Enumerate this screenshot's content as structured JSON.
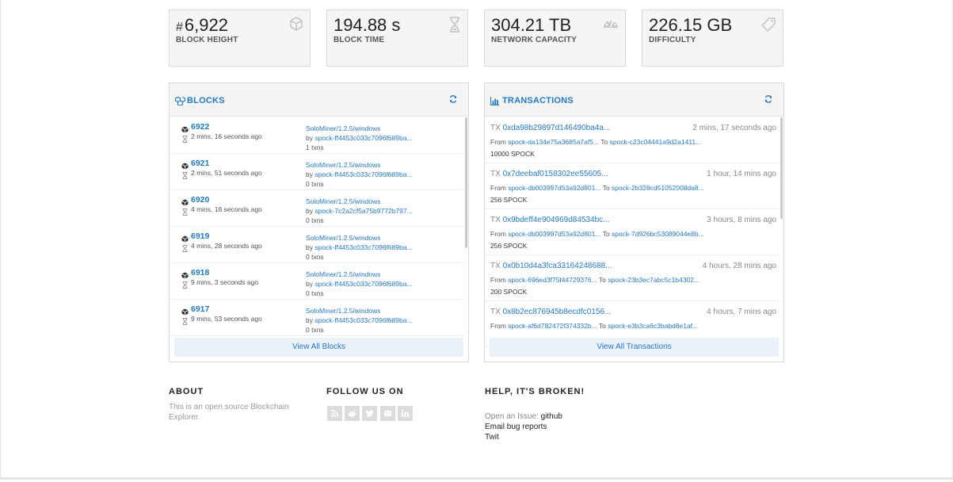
{
  "stats": [
    {
      "prefix": "#",
      "value": "6,922",
      "label": "BLOCK HEIGHT",
      "icon": "cube-icon"
    },
    {
      "prefix": "",
      "value": "194.88 s",
      "label": "BLOCK TIME",
      "icon": "hourglass-icon"
    },
    {
      "prefix": "",
      "value": "304.21 TB",
      "label": "NETWORK CAPACITY",
      "icon": "dashboard-icon"
    },
    {
      "prefix": "",
      "value": "226.15 GB",
      "label": "DIFFICULTY",
      "icon": "tag-icon"
    }
  ],
  "blocks_panel": {
    "title": "BLOCKS",
    "view_all": "View All Blocks",
    "items": [
      {
        "number": "6922",
        "time": "2 mins, 16 seconds ago",
        "miner": "SoloMiner/1.2.5/windows",
        "by_prefix": "by ",
        "by": "spock-ff4453c033c7096f689ba...",
        "txns": "1 txns"
      },
      {
        "number": "6921",
        "time": "2 mins, 51 seconds ago",
        "miner": "SoloMiner/1.2.5/windows",
        "by_prefix": "by ",
        "by": "spock-ff4453c033c7096f689ba...",
        "txns": "0 txns"
      },
      {
        "number": "6920",
        "time": "4 mins, 18 seconds ago",
        "miner": "SoloMiner/1.2.5/windows",
        "by_prefix": "by ",
        "by": "spock-7c2a2cf5a75b9772b797...",
        "txns": "0 txns"
      },
      {
        "number": "6919",
        "time": "4 mins, 28 seconds ago",
        "miner": "SoloMiner/1.2.5/windows",
        "by_prefix": "by ",
        "by": "spock-ff4453c033c7096f689ba...",
        "txns": "0 txns"
      },
      {
        "number": "6918",
        "time": "9 mins, 3 seconds ago",
        "miner": "SoloMiner/1.2.5/windows",
        "by_prefix": "by ",
        "by": "spock-ff4453c033c7096f689ba...",
        "txns": "0 txns"
      },
      {
        "number": "6917",
        "time": "9 mins, 53 seconds ago",
        "miner": "SoloMiner/1.2.5/windows",
        "by_prefix": "by ",
        "by": "spock-ff4453c033c7096f689ba...",
        "txns": "0 txns"
      }
    ]
  },
  "transactions_panel": {
    "title": "TRANSACTIONS",
    "view_all": "View All Transactions",
    "items": [
      {
        "tx_prefix": "TX ",
        "hash": "0xda98b29897d146490ba4a...",
        "ago": "2 mins, 17 seconds ago",
        "from_label": "From ",
        "from": "spock-da134e75a3685a7af5...",
        "to_label": " To ",
        "to": "spock-c23c04441a9d2a1411...",
        "amount": "10000 SPOCK"
      },
      {
        "tx_prefix": "TX ",
        "hash": "0x7deebaf0158302ee55605...",
        "ago": "1 hour, 14 mins ago",
        "from_label": "From ",
        "from": "spock-db003997d53a92d801...",
        "to_label": " To ",
        "to": "spock-2b328cd51052008da8...",
        "amount": "256 SPOCK"
      },
      {
        "tx_prefix": "TX ",
        "hash": "0x9bdeff4e904969d84534bc...",
        "ago": "3 hours, 8 mins ago",
        "from_label": "From ",
        "from": "spock-db003997d53a92d801...",
        "to_label": " To ",
        "to": "spock-7d926bc53089044e8b...",
        "amount": "256 SPOCK"
      },
      {
        "tx_prefix": "TX ",
        "hash": "0x0b10d4a3fca33164248688...",
        "ago": "4 hours, 28 mins ago",
        "from_label": "From ",
        "from": "spock-696ed3f75f44729376...",
        "to_label": " To ",
        "to": "spock-23b3ec7abc5c1b4302...",
        "amount": "200 SPOCK"
      },
      {
        "tx_prefix": "TX ",
        "hash": "0x8b2ec876945b8ecdfc0156...",
        "ago": "4 hours, 7 mins ago",
        "from_label": "From ",
        "from": "spock-af6d782472f374332b...",
        "to_label": " To ",
        "to": "spock-e3b3ca6c3babd8e1af...",
        "amount": ""
      }
    ]
  },
  "footer": {
    "about_title": "ABOUT",
    "about_text": "This is an open source Blockchain Explorer.",
    "follow_title": "FOLLOW US ON",
    "social_icons": [
      "rss-icon",
      "reddit-icon",
      "twitter-icon",
      "github-icon",
      "linkedin-icon"
    ],
    "help_title": "HELP, IT'S BROKEN!",
    "issue_prefix": "Open an Issue: ",
    "issue_link": "github",
    "email_link": "Email bug reports",
    "twit_link": "Twit"
  },
  "colors": {
    "accent": "#2479c4",
    "panel_bg": "#f5f5f5",
    "icon_grey": "#c3c7cc"
  }
}
